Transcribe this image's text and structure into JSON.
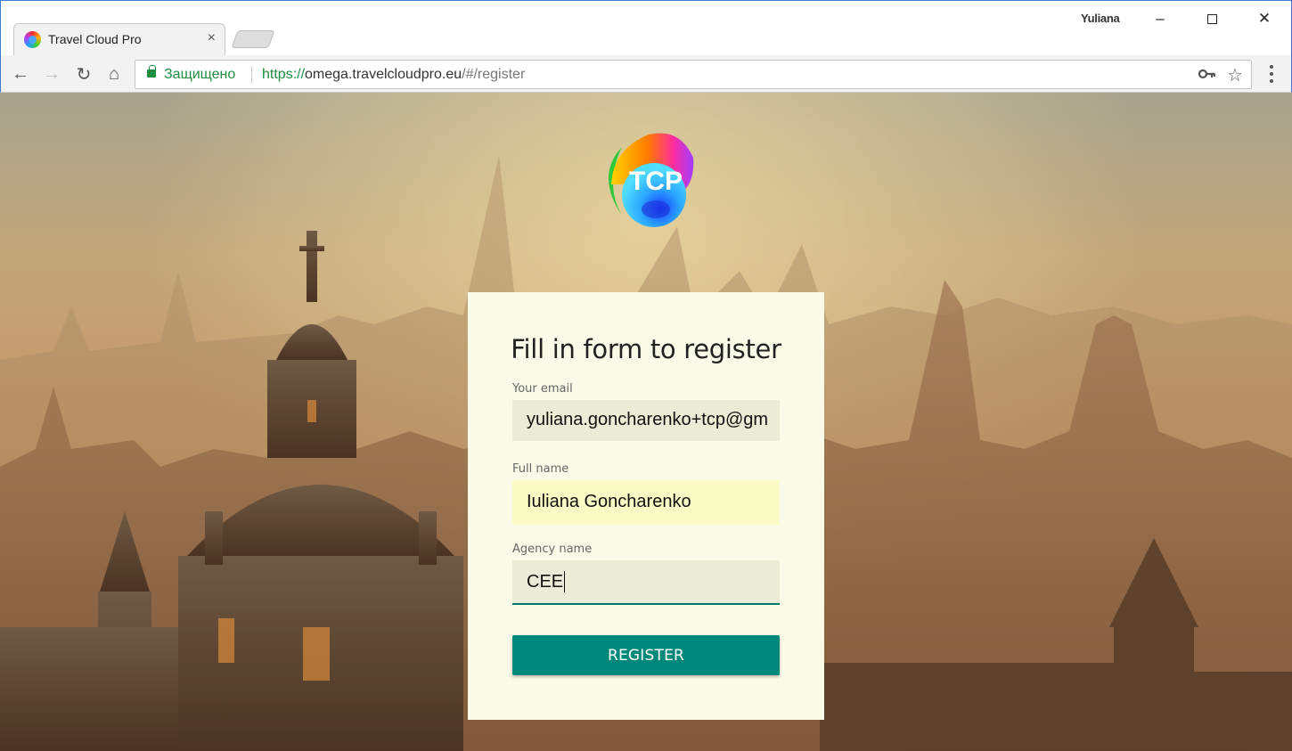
{
  "browser": {
    "tab_title": "Travel Cloud Pro",
    "tab_close": "×",
    "profile_name": "Yuliana",
    "window_controls": {
      "minimize": "–",
      "close": "✕"
    },
    "nav": {
      "back": "←",
      "forward": "→",
      "reload": "↻",
      "home": "⌂"
    },
    "omnibox": {
      "secure_label": "Защищено",
      "url_scheme": "https://",
      "url_host": "omega.travelcloudpro.eu",
      "url_path": "/#/register"
    },
    "icons": {
      "key": "key-icon",
      "star": "star-icon",
      "menu": "menu-icon"
    }
  },
  "page": {
    "logo_text": "TCP",
    "form": {
      "title": "Fill in form to register",
      "email": {
        "label": "Your email",
        "value": "yuliana.goncharenko+tcp@gm"
      },
      "full_name": {
        "label": "Full name",
        "value": "Iuliana Goncharenko"
      },
      "agency": {
        "label": "Agency name",
        "value": "CEE"
      },
      "submit_label": "REGISTER"
    }
  },
  "colors": {
    "accent": "#00897b",
    "card_background": "#fafae8",
    "secure_green": "#1e8e3e",
    "autofill_yellow": "#fafcc6"
  }
}
